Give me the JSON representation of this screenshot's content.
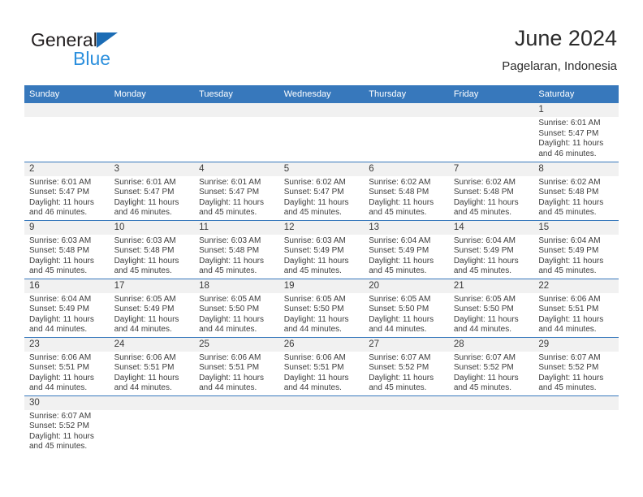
{
  "brand": {
    "name_part1": "General",
    "name_part2": "Blue",
    "triangle_color": "#1b6cb5",
    "blue_text_color": "#2b8fdd"
  },
  "header": {
    "title": "June 2024",
    "subtitle": "Pagelaran, Indonesia"
  },
  "theme": {
    "header_bar_color": "#3778bc",
    "day_band_color": "#f1f1f1",
    "row_border_color": "#3778bc"
  },
  "calendar": {
    "weekdays": [
      "Sunday",
      "Monday",
      "Tuesday",
      "Wednesday",
      "Thursday",
      "Friday",
      "Saturday"
    ],
    "weeks": [
      [
        {
          "day": "",
          "lines": []
        },
        {
          "day": "",
          "lines": []
        },
        {
          "day": "",
          "lines": []
        },
        {
          "day": "",
          "lines": []
        },
        {
          "day": "",
          "lines": []
        },
        {
          "day": "",
          "lines": []
        },
        {
          "day": "1",
          "lines": [
            "Sunrise: 6:01 AM",
            "Sunset: 5:47 PM",
            "Daylight: 11 hours",
            "and 46 minutes."
          ]
        }
      ],
      [
        {
          "day": "2",
          "lines": [
            "Sunrise: 6:01 AM",
            "Sunset: 5:47 PM",
            "Daylight: 11 hours",
            "and 46 minutes."
          ]
        },
        {
          "day": "3",
          "lines": [
            "Sunrise: 6:01 AM",
            "Sunset: 5:47 PM",
            "Daylight: 11 hours",
            "and 46 minutes."
          ]
        },
        {
          "day": "4",
          "lines": [
            "Sunrise: 6:01 AM",
            "Sunset: 5:47 PM",
            "Daylight: 11 hours",
            "and 45 minutes."
          ]
        },
        {
          "day": "5",
          "lines": [
            "Sunrise: 6:02 AM",
            "Sunset: 5:47 PM",
            "Daylight: 11 hours",
            "and 45 minutes."
          ]
        },
        {
          "day": "6",
          "lines": [
            "Sunrise: 6:02 AM",
            "Sunset: 5:48 PM",
            "Daylight: 11 hours",
            "and 45 minutes."
          ]
        },
        {
          "day": "7",
          "lines": [
            "Sunrise: 6:02 AM",
            "Sunset: 5:48 PM",
            "Daylight: 11 hours",
            "and 45 minutes."
          ]
        },
        {
          "day": "8",
          "lines": [
            "Sunrise: 6:02 AM",
            "Sunset: 5:48 PM",
            "Daylight: 11 hours",
            "and 45 minutes."
          ]
        }
      ],
      [
        {
          "day": "9",
          "lines": [
            "Sunrise: 6:03 AM",
            "Sunset: 5:48 PM",
            "Daylight: 11 hours",
            "and 45 minutes."
          ]
        },
        {
          "day": "10",
          "lines": [
            "Sunrise: 6:03 AM",
            "Sunset: 5:48 PM",
            "Daylight: 11 hours",
            "and 45 minutes."
          ]
        },
        {
          "day": "11",
          "lines": [
            "Sunrise: 6:03 AM",
            "Sunset: 5:48 PM",
            "Daylight: 11 hours",
            "and 45 minutes."
          ]
        },
        {
          "day": "12",
          "lines": [
            "Sunrise: 6:03 AM",
            "Sunset: 5:49 PM",
            "Daylight: 11 hours",
            "and 45 minutes."
          ]
        },
        {
          "day": "13",
          "lines": [
            "Sunrise: 6:04 AM",
            "Sunset: 5:49 PM",
            "Daylight: 11 hours",
            "and 45 minutes."
          ]
        },
        {
          "day": "14",
          "lines": [
            "Sunrise: 6:04 AM",
            "Sunset: 5:49 PM",
            "Daylight: 11 hours",
            "and 45 minutes."
          ]
        },
        {
          "day": "15",
          "lines": [
            "Sunrise: 6:04 AM",
            "Sunset: 5:49 PM",
            "Daylight: 11 hours",
            "and 45 minutes."
          ]
        }
      ],
      [
        {
          "day": "16",
          "lines": [
            "Sunrise: 6:04 AM",
            "Sunset: 5:49 PM",
            "Daylight: 11 hours",
            "and 44 minutes."
          ]
        },
        {
          "day": "17",
          "lines": [
            "Sunrise: 6:05 AM",
            "Sunset: 5:49 PM",
            "Daylight: 11 hours",
            "and 44 minutes."
          ]
        },
        {
          "day": "18",
          "lines": [
            "Sunrise: 6:05 AM",
            "Sunset: 5:50 PM",
            "Daylight: 11 hours",
            "and 44 minutes."
          ]
        },
        {
          "day": "19",
          "lines": [
            "Sunrise: 6:05 AM",
            "Sunset: 5:50 PM",
            "Daylight: 11 hours",
            "and 44 minutes."
          ]
        },
        {
          "day": "20",
          "lines": [
            "Sunrise: 6:05 AM",
            "Sunset: 5:50 PM",
            "Daylight: 11 hours",
            "and 44 minutes."
          ]
        },
        {
          "day": "21",
          "lines": [
            "Sunrise: 6:05 AM",
            "Sunset: 5:50 PM",
            "Daylight: 11 hours",
            "and 44 minutes."
          ]
        },
        {
          "day": "22",
          "lines": [
            "Sunrise: 6:06 AM",
            "Sunset: 5:51 PM",
            "Daylight: 11 hours",
            "and 44 minutes."
          ]
        }
      ],
      [
        {
          "day": "23",
          "lines": [
            "Sunrise: 6:06 AM",
            "Sunset: 5:51 PM",
            "Daylight: 11 hours",
            "and 44 minutes."
          ]
        },
        {
          "day": "24",
          "lines": [
            "Sunrise: 6:06 AM",
            "Sunset: 5:51 PM",
            "Daylight: 11 hours",
            "and 44 minutes."
          ]
        },
        {
          "day": "25",
          "lines": [
            "Sunrise: 6:06 AM",
            "Sunset: 5:51 PM",
            "Daylight: 11 hours",
            "and 44 minutes."
          ]
        },
        {
          "day": "26",
          "lines": [
            "Sunrise: 6:06 AM",
            "Sunset: 5:51 PM",
            "Daylight: 11 hours",
            "and 44 minutes."
          ]
        },
        {
          "day": "27",
          "lines": [
            "Sunrise: 6:07 AM",
            "Sunset: 5:52 PM",
            "Daylight: 11 hours",
            "and 45 minutes."
          ]
        },
        {
          "day": "28",
          "lines": [
            "Sunrise: 6:07 AM",
            "Sunset: 5:52 PM",
            "Daylight: 11 hours",
            "and 45 minutes."
          ]
        },
        {
          "day": "29",
          "lines": [
            "Sunrise: 6:07 AM",
            "Sunset: 5:52 PM",
            "Daylight: 11 hours",
            "and 45 minutes."
          ]
        }
      ],
      [
        {
          "day": "30",
          "lines": [
            "Sunrise: 6:07 AM",
            "Sunset: 5:52 PM",
            "Daylight: 11 hours",
            "and 45 minutes."
          ]
        },
        {
          "day": "",
          "lines": []
        },
        {
          "day": "",
          "lines": []
        },
        {
          "day": "",
          "lines": []
        },
        {
          "day": "",
          "lines": []
        },
        {
          "day": "",
          "lines": []
        },
        {
          "day": "",
          "lines": []
        }
      ]
    ]
  }
}
